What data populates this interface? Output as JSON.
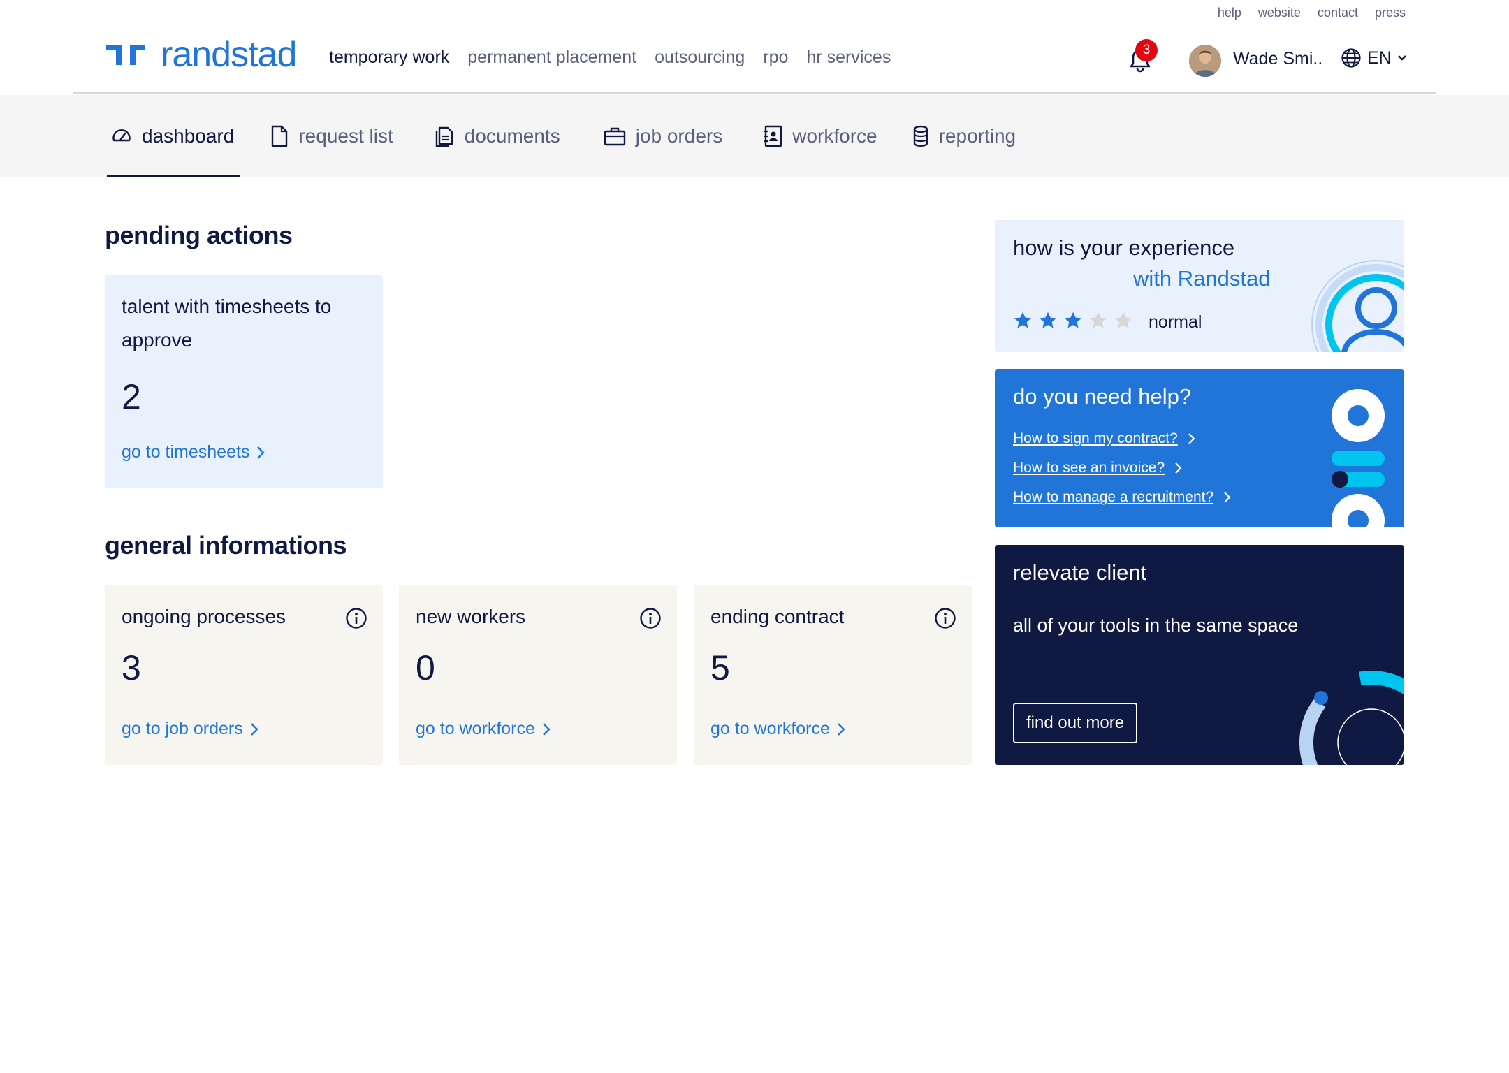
{
  "top_links": [
    "help",
    "website",
    "contact",
    "press"
  ],
  "brand": {
    "name": "randstad",
    "color": "#2175d9"
  },
  "main_nav": [
    {
      "label": "temporary work",
      "active": true
    },
    {
      "label": "permanent placement",
      "active": false
    },
    {
      "label": "outsourcing",
      "active": false
    },
    {
      "label": "rpo",
      "active": false
    },
    {
      "label": "hr services",
      "active": false
    }
  ],
  "notifications": {
    "count": "3",
    "icon": "bell-icon"
  },
  "user": {
    "name": "Wade Smi.."
  },
  "language": {
    "code": "EN",
    "icon": "globe-icon"
  },
  "tabs": [
    {
      "label": "dashboard",
      "icon": "dashboard-gauge-icon",
      "active": true
    },
    {
      "label": "request list",
      "icon": "document-icon",
      "active": false
    },
    {
      "label": "documents",
      "icon": "documents-icon",
      "active": false
    },
    {
      "label": "job orders",
      "icon": "briefcase-icon",
      "active": false
    },
    {
      "label": "workforce",
      "icon": "contact-book-icon",
      "active": false
    },
    {
      "label": "reporting",
      "icon": "database-icon",
      "active": false
    }
  ],
  "pending_actions": {
    "title": "pending actions",
    "cards": [
      {
        "title": "talent with timesheets to approve",
        "value": "2",
        "link": "go to timesheets"
      }
    ]
  },
  "general_informations": {
    "title": "general informations",
    "cards": [
      {
        "title": "ongoing processes",
        "value": "3",
        "link": "go to job orders"
      },
      {
        "title": "new workers",
        "value": "0",
        "link": "go to workforce"
      },
      {
        "title": "ending contract",
        "value": "5",
        "link": "go to workforce"
      }
    ]
  },
  "experience": {
    "line1": "how is your experience",
    "line2": "with Randstad",
    "rating": 3,
    "rating_max": 5,
    "rating_label": "normal"
  },
  "help": {
    "title": "do you need help?",
    "links": [
      "How to sign my contract?",
      "How to see an invoice?",
      "How to manage a recruitment?"
    ]
  },
  "promo": {
    "title": "relevate client",
    "subtitle": "all of your tools in the same space",
    "button": "find out more"
  },
  "colors": {
    "navy": "#0f1941",
    "blue": "#2175d9",
    "light_blue_bg": "#e8f1fc",
    "beige_bg": "#f7f5f0",
    "cyan": "#00c4f0",
    "badge_red": "#e30613",
    "star_empty": "#d7d7d7"
  }
}
